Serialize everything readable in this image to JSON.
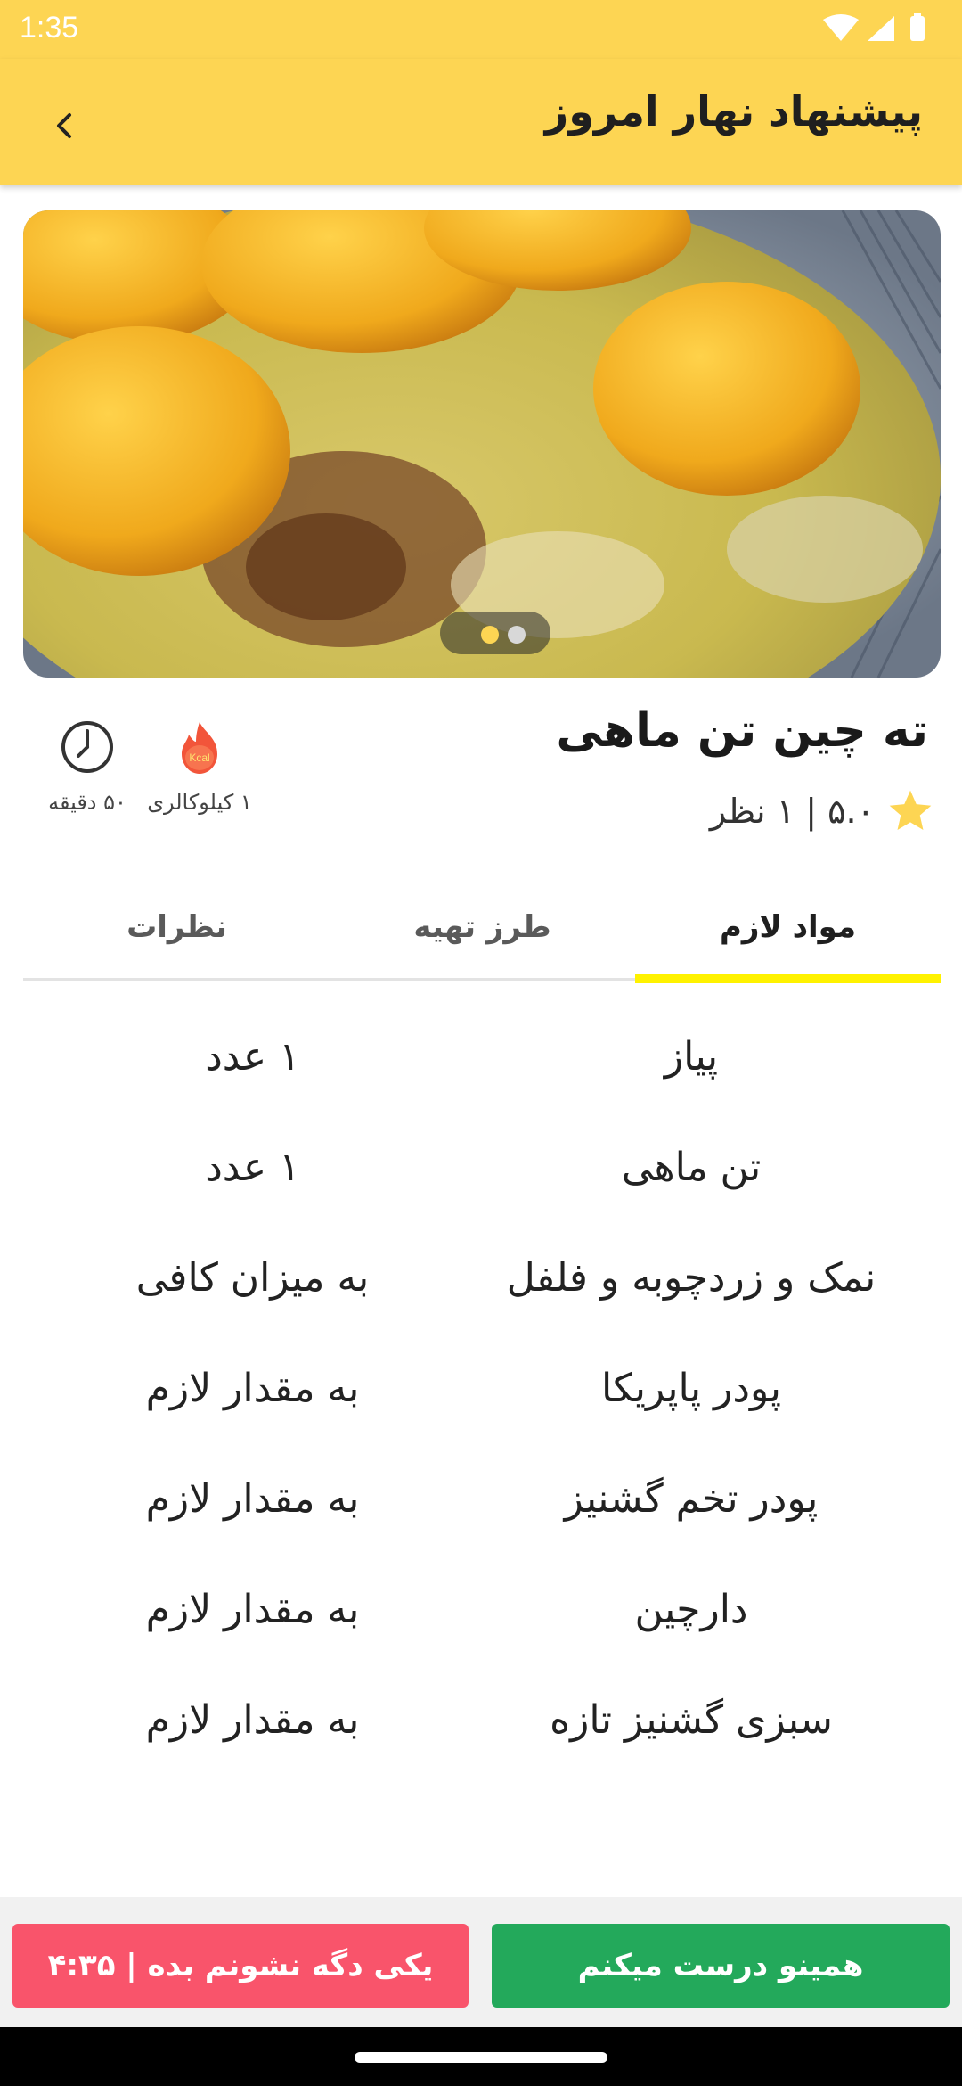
{
  "status_bar": {
    "time": "1:35",
    "icons": [
      "wifi-icon",
      "signal-icon",
      "battery-icon"
    ]
  },
  "app_bar": {
    "title": "پیشنهاد نهار امروز",
    "back_icon": "chevron-left-icon"
  },
  "hero": {
    "image_description": "food-photo",
    "pager": {
      "count": 2,
      "active_index": 0
    }
  },
  "recipe": {
    "title": "ته چین تن ماهی",
    "rating_text": "۵.۰ | ۱ نظر",
    "calories_label": "۱ کیلوکالری",
    "time_label": "۵۰ دقیقه",
    "kcal_icon_text": "Kcal"
  },
  "tabs": [
    {
      "label": "مواد لازم",
      "active": true
    },
    {
      "label": "طرز تهیه",
      "active": false
    },
    {
      "label": "نظرات",
      "active": false
    }
  ],
  "ingredients": [
    {
      "name": "پیاز",
      "qty": "۱ عدد"
    },
    {
      "name": "تن ماهی",
      "qty": "۱ عدد"
    },
    {
      "name": "نمک و زردچوبه و فلفل",
      "qty": "به میزان کافی"
    },
    {
      "name": "پودر پاپریکا",
      "qty": "به مقدار لازم"
    },
    {
      "name": "پودر تخم گشنیز",
      "qty": "به مقدار لازم"
    },
    {
      "name": "دارچین",
      "qty": "به مقدار لازم"
    },
    {
      "name": "سبزی گشنیز تازه",
      "qty": "به مقدار لازم"
    }
  ],
  "actions": {
    "confirm_label": "همینو درست میکنم",
    "another_label": "یکی دگه نشونم بده | ۴:۳۵"
  },
  "colors": {
    "accent": "#FDD553",
    "tab_indicator": "#FFF200",
    "confirm": "#23A95B",
    "another": "#F9546B",
    "star": "#FDD553"
  }
}
